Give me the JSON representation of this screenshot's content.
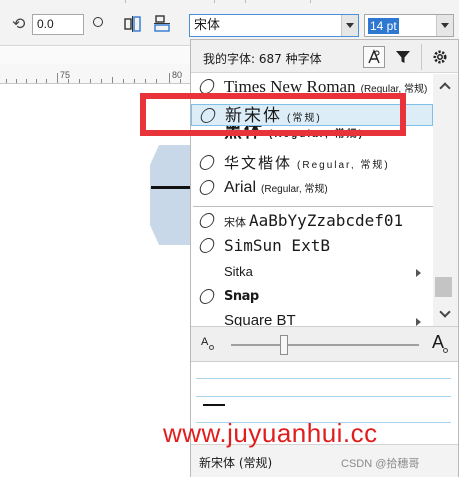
{
  "toolbar": {
    "rotation_value": "0.0",
    "font_name": "宋体",
    "font_size": "14 pt"
  },
  "ruler": {
    "ticks": [
      "75",
      "80"
    ]
  },
  "panel": {
    "title": "我的字体: 687 种字体",
    "fonts": [
      {
        "name": "Times New Roman",
        "style": "(Regular, 常规)"
      },
      {
        "name": "新宋体",
        "style": "(常规)",
        "selected": true
      },
      {
        "name": "黑体",
        "style": "(Regular, 常规)"
      },
      {
        "name": "华文楷体",
        "style": "(Regular, 常规)"
      },
      {
        "name": "Arial",
        "style": "(Regular, 常规)"
      },
      {
        "name": "宋体",
        "sample": "AaBbYyZzabcdef01"
      },
      {
        "name": "SimSun ExtB"
      },
      {
        "name": "Sitka"
      },
      {
        "name": "Snap"
      },
      {
        "name": "Square BT"
      }
    ],
    "zoom_small": "A",
    "zoom_large": "A",
    "status": "新宋体 (常规)"
  },
  "credit": "CSDN @拾穗哥",
  "watermark": "www.juyuanhui.cc",
  "colors": {
    "highlight": "#e8333a",
    "watermark": "#e11d1d",
    "selection": "#dcedf8"
  }
}
